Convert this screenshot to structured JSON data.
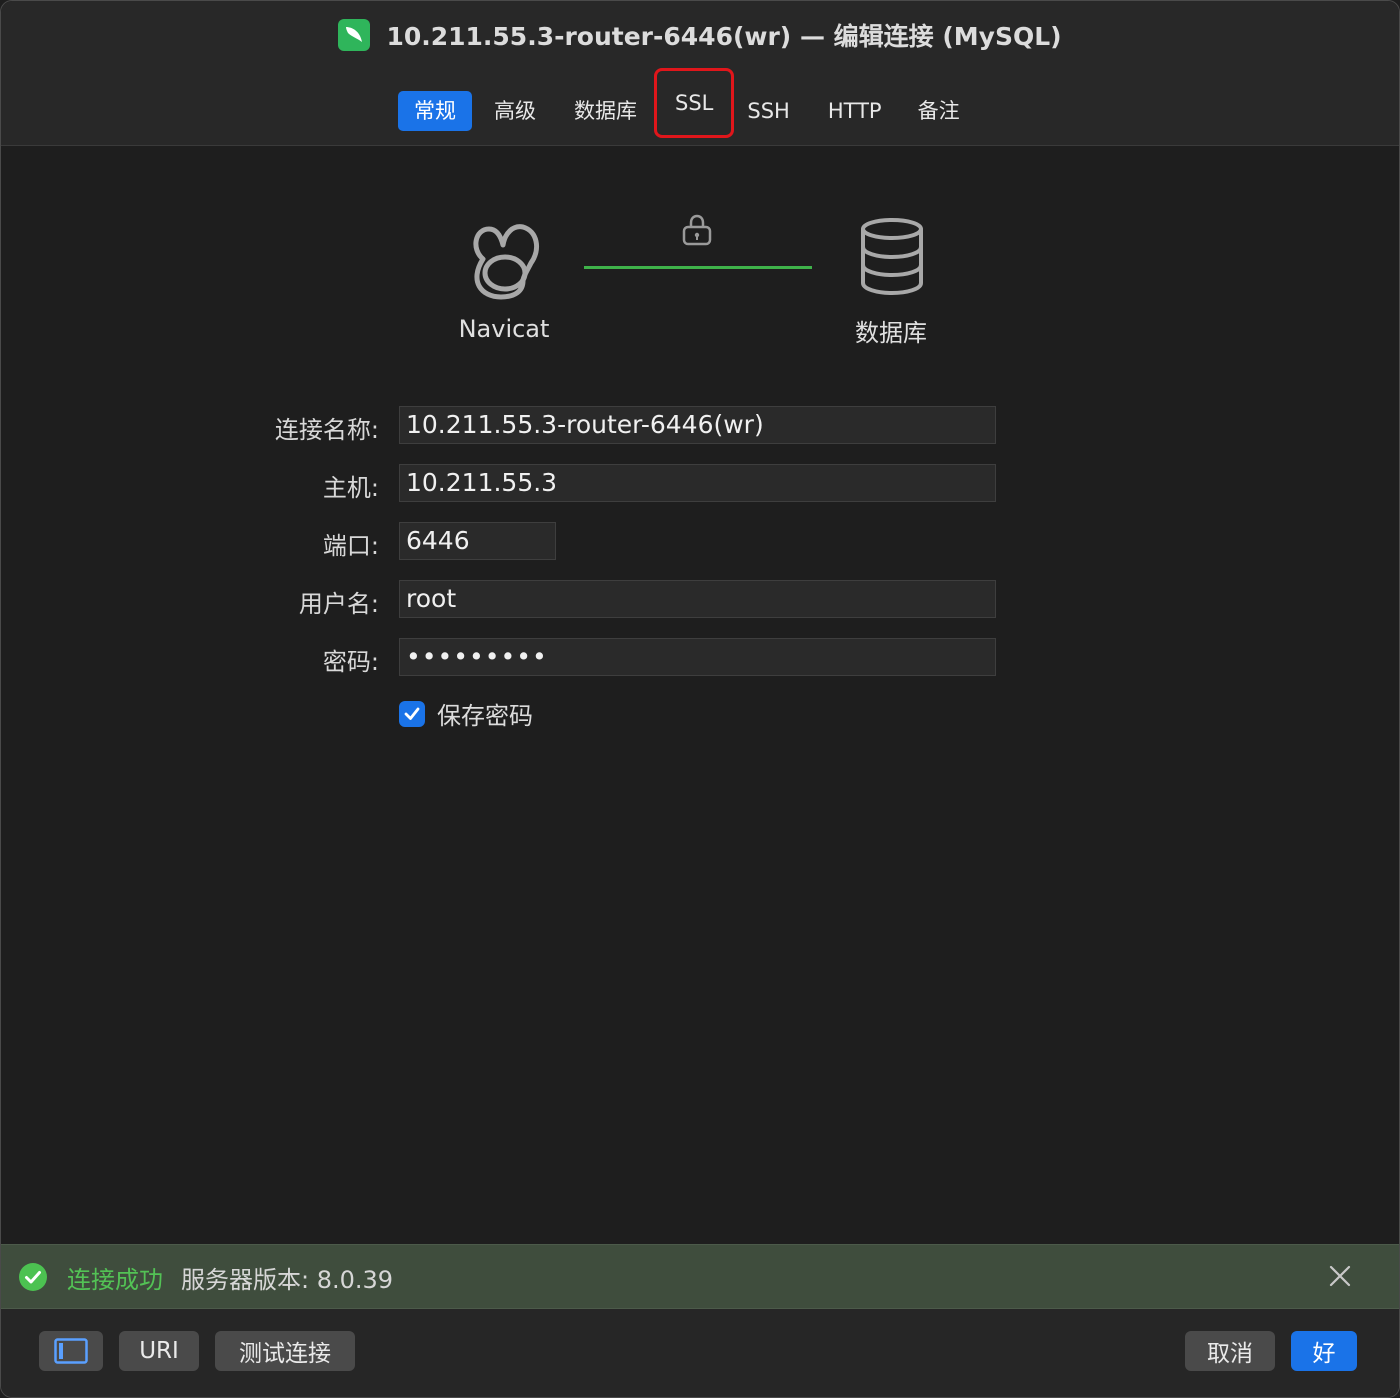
{
  "window": {
    "title": "10.211.55.3-router-6446(wr) — 编辑连接 (MySQL)"
  },
  "tabs": [
    {
      "label": "常规",
      "active": true
    },
    {
      "label": "高级"
    },
    {
      "label": "数据库"
    },
    {
      "label": "SSL",
      "highlighted": true
    },
    {
      "label": "SSH"
    },
    {
      "label": "HTTP"
    },
    {
      "label": "备注"
    }
  ],
  "diagram": {
    "client_label": "Navicat",
    "server_label": "数据库",
    "line_color": "#3fb24a"
  },
  "form": {
    "connection_name": {
      "label": "连接名称:",
      "value": "10.211.55.3-router-6446(wr)"
    },
    "host": {
      "label": "主机:",
      "value": "10.211.55.3"
    },
    "port": {
      "label": "端口:",
      "value": "6446"
    },
    "username": {
      "label": "用户名:",
      "value": "root"
    },
    "password": {
      "label": "密码:",
      "value": "•••••••••"
    },
    "save_password": {
      "label": "保存密码",
      "checked": true
    }
  },
  "status": {
    "success_text": "连接成功",
    "version_text": "服务器版本: 8.0.39",
    "success_color": "#53c255"
  },
  "footer": {
    "sidebar_toggle_icon": "sidebar-icon",
    "uri_label": "URI",
    "test_label": "测试连接",
    "cancel_label": "取消",
    "ok_label": "好"
  },
  "colors": {
    "accent": "#1a73e8",
    "highlight_outline": "#e0161b"
  }
}
